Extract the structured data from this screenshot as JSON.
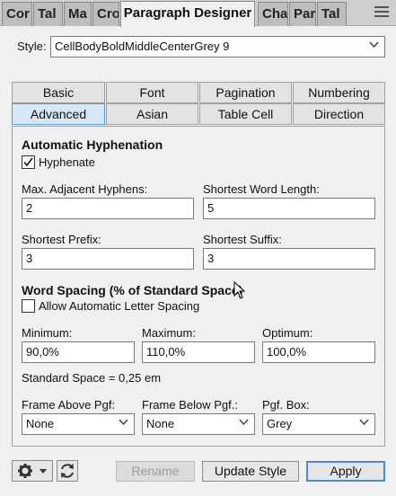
{
  "panel_tabs": [
    "Cor",
    "Tal",
    "Ma",
    "Cro",
    "Paragraph Designer",
    "Cha",
    "Par",
    "Tal"
  ],
  "style": {
    "label": "Style:",
    "value": "CellBodyBoldMiddleCenterGrey 9"
  },
  "dialog_tabs": {
    "row1": [
      "Basic",
      "Font",
      "Pagination",
      "Numbering"
    ],
    "row2": [
      "Advanced",
      "Asian",
      "Table Cell",
      "Direction"
    ],
    "selected": "Advanced"
  },
  "hyphenation": {
    "heading": "Automatic Hyphenation",
    "hyphenate_label": "Hyphenate",
    "hyphenate_checked": true,
    "max_hyphens_label": "Max. Adjacent Hyphens:",
    "max_hyphens_value": "2",
    "shortest_word_label": "Shortest Word Length:",
    "shortest_word_value": "5",
    "shortest_prefix_label": "Shortest Prefix:",
    "shortest_prefix_value": "3",
    "shortest_suffix_label": "Shortest Suffix:",
    "shortest_suffix_value": "3"
  },
  "word_spacing": {
    "heading": "Word Spacing (% of Standard Space)",
    "allow_letter_spacing_label": "Allow Automatic Letter Spacing",
    "allow_letter_spacing_checked": false,
    "minimum_label": "Minimum:",
    "minimum_value": "90,0%",
    "maximum_label": "Maximum:",
    "maximum_value": "110,0%",
    "optimum_label": "Optimum:",
    "optimum_value": "100,0%",
    "standard_space": "Standard Space = 0,25 em"
  },
  "frames": {
    "above_label": "Frame Above Pgf:",
    "above_value": "None",
    "below_label": "Frame Below Pgf.:",
    "below_value": "None",
    "pgf_box_label": "Pgf. Box:",
    "pgf_box_value": "Grey"
  },
  "buttons": {
    "rename": "Rename",
    "update_style": "Update Style",
    "apply": "Apply"
  },
  "icons": {
    "menu": "hamburger-menu-icon",
    "settings": "gear-icon",
    "refresh": "refresh-icon"
  },
  "colors": {
    "selected_tab_bg": "#d6e8f7",
    "selected_tab_border": "#5c9bd6",
    "apply_border": "#4a8bd1"
  }
}
